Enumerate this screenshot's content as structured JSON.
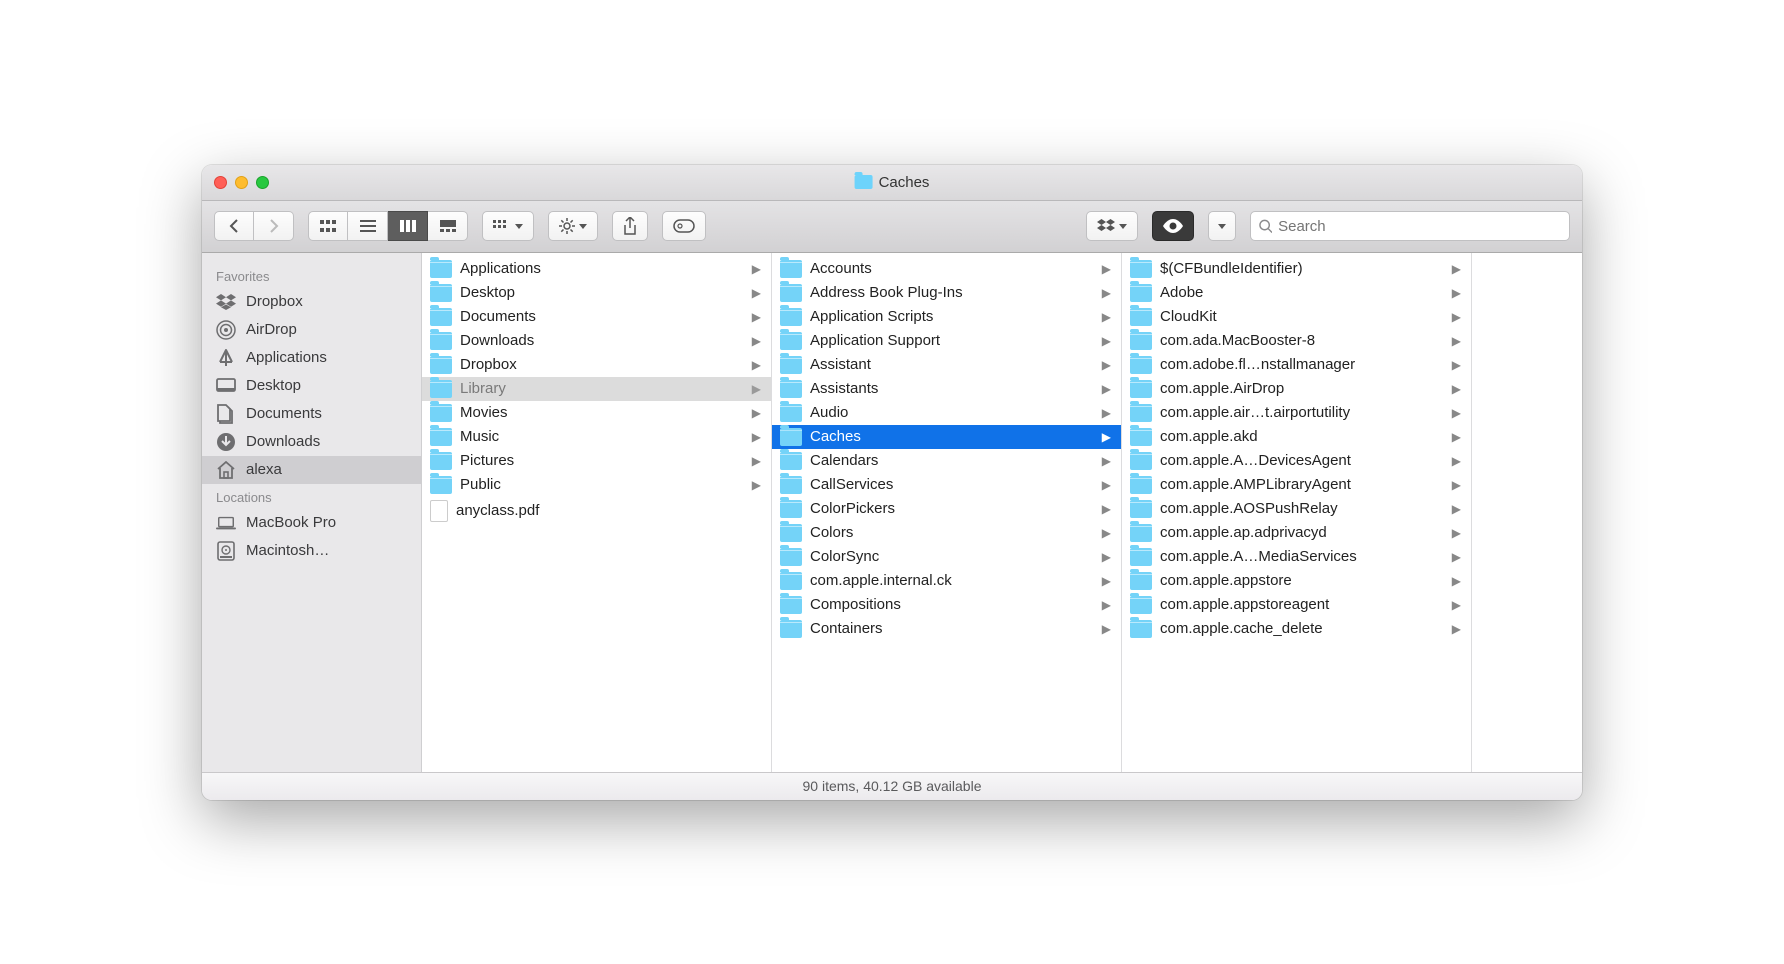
{
  "window": {
    "title": "Caches"
  },
  "search": {
    "placeholder": "Search"
  },
  "status": {
    "text": "90 items, 40.12 GB available"
  },
  "sidebar": {
    "sections": [
      {
        "header": "Favorites",
        "items": [
          {
            "icon": "dropbox",
            "label": "Dropbox",
            "selected": false
          },
          {
            "icon": "airdrop",
            "label": "AirDrop",
            "selected": false
          },
          {
            "icon": "apps",
            "label": "Applications",
            "selected": false
          },
          {
            "icon": "desktop",
            "label": "Desktop",
            "selected": false
          },
          {
            "icon": "documents",
            "label": "Documents",
            "selected": false
          },
          {
            "icon": "downloads",
            "label": "Downloads",
            "selected": false
          },
          {
            "icon": "home",
            "label": "alexa",
            "selected": true
          }
        ]
      },
      {
        "header": "Locations",
        "items": [
          {
            "icon": "laptop",
            "label": "MacBook Pro",
            "selected": false
          },
          {
            "icon": "disk",
            "label": "Macintosh…",
            "selected": false
          }
        ]
      }
    ]
  },
  "columns": [
    {
      "items": [
        {
          "type": "folder",
          "label": "Applications",
          "state": "normal"
        },
        {
          "type": "folder",
          "label": "Desktop",
          "state": "normal"
        },
        {
          "type": "folder",
          "label": "Documents",
          "state": "normal"
        },
        {
          "type": "folder",
          "label": "Downloads",
          "state": "normal"
        },
        {
          "type": "folder",
          "label": "Dropbox",
          "state": "normal"
        },
        {
          "type": "folder",
          "label": "Library",
          "state": "grey"
        },
        {
          "type": "folder",
          "label": "Movies",
          "state": "normal"
        },
        {
          "type": "folder",
          "label": "Music",
          "state": "normal"
        },
        {
          "type": "folder",
          "label": "Pictures",
          "state": "normal"
        },
        {
          "type": "folder",
          "label": "Public",
          "state": "normal"
        },
        {
          "type": "pdf",
          "label": "anyclass.pdf",
          "state": "normal",
          "no_chev": true
        }
      ]
    },
    {
      "items": [
        {
          "type": "folder",
          "label": "Accounts",
          "state": "normal"
        },
        {
          "type": "folder",
          "label": "Address Book Plug-Ins",
          "state": "normal"
        },
        {
          "type": "folder",
          "label": "Application Scripts",
          "state": "normal"
        },
        {
          "type": "folder",
          "label": "Application Support",
          "state": "normal"
        },
        {
          "type": "folder",
          "label": "Assistant",
          "state": "normal"
        },
        {
          "type": "folder",
          "label": "Assistants",
          "state": "normal"
        },
        {
          "type": "folder",
          "label": "Audio",
          "state": "normal"
        },
        {
          "type": "folder",
          "label": "Caches",
          "state": "blue"
        },
        {
          "type": "folder",
          "label": "Calendars",
          "state": "normal"
        },
        {
          "type": "folder",
          "label": "CallServices",
          "state": "normal"
        },
        {
          "type": "folder",
          "label": "ColorPickers",
          "state": "normal"
        },
        {
          "type": "folder",
          "label": "Colors",
          "state": "normal"
        },
        {
          "type": "folder",
          "label": "ColorSync",
          "state": "normal"
        },
        {
          "type": "folder",
          "label": "com.apple.internal.ck",
          "state": "normal"
        },
        {
          "type": "folder",
          "label": "Compositions",
          "state": "normal"
        },
        {
          "type": "folder",
          "label": "Containers",
          "state": "normal"
        }
      ]
    },
    {
      "items": [
        {
          "type": "folder",
          "label": "$(CFBundleIdentifier)",
          "state": "normal"
        },
        {
          "type": "folder",
          "label": "Adobe",
          "state": "normal"
        },
        {
          "type": "folder",
          "label": "CloudKit",
          "state": "normal"
        },
        {
          "type": "folder",
          "label": "com.ada.MacBooster-8",
          "state": "normal"
        },
        {
          "type": "folder",
          "label": "com.adobe.fl…nstallmanager",
          "state": "normal"
        },
        {
          "type": "folder",
          "label": "com.apple.AirDrop",
          "state": "normal"
        },
        {
          "type": "folder",
          "label": "com.apple.air…t.airportutility",
          "state": "normal"
        },
        {
          "type": "folder",
          "label": "com.apple.akd",
          "state": "normal"
        },
        {
          "type": "folder",
          "label": "com.apple.A…DevicesAgent",
          "state": "normal"
        },
        {
          "type": "folder",
          "label": "com.apple.AMPLibraryAgent",
          "state": "normal"
        },
        {
          "type": "folder",
          "label": "com.apple.AOSPushRelay",
          "state": "normal"
        },
        {
          "type": "folder",
          "label": "com.apple.ap.adprivacyd",
          "state": "normal"
        },
        {
          "type": "folder",
          "label": "com.apple.A…MediaServices",
          "state": "normal"
        },
        {
          "type": "folder",
          "label": "com.apple.appstore",
          "state": "normal"
        },
        {
          "type": "folder",
          "label": "com.apple.appstoreagent",
          "state": "normal"
        },
        {
          "type": "folder",
          "label": "com.apple.cache_delete",
          "state": "normal"
        }
      ]
    }
  ]
}
